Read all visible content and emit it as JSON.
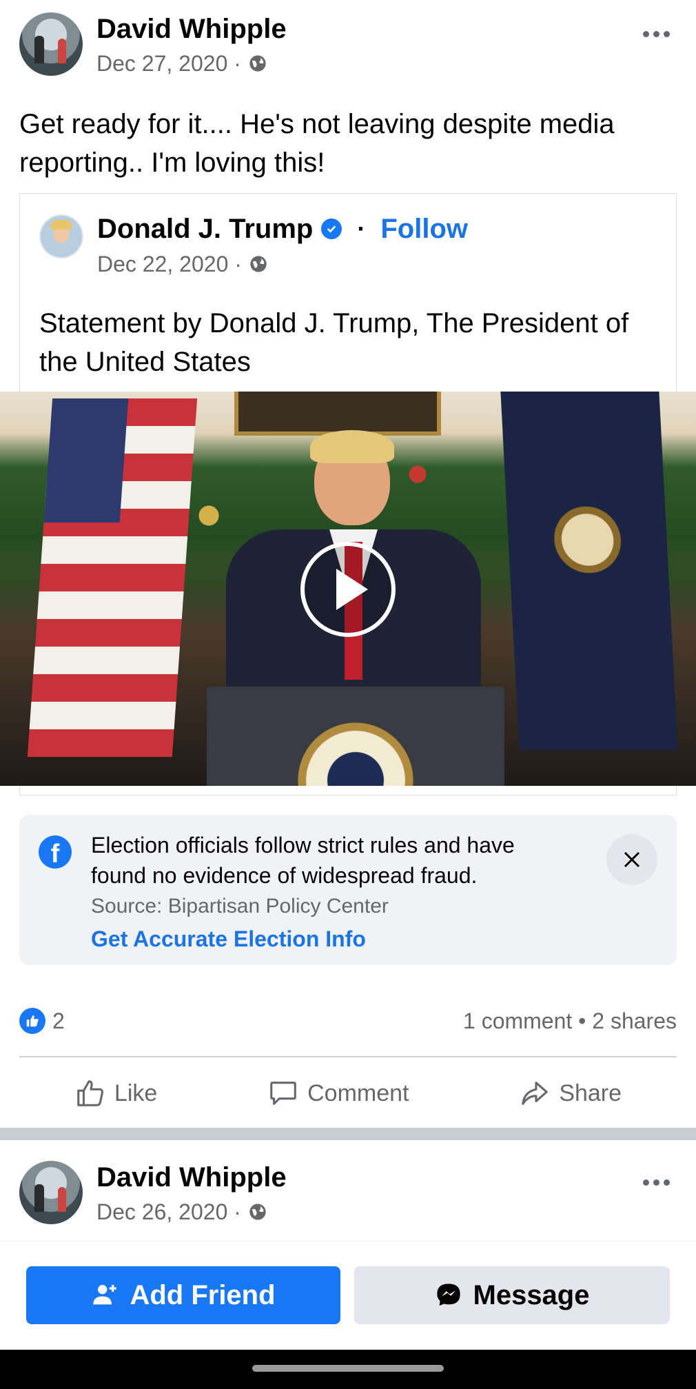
{
  "post": {
    "author": "David Whipple",
    "date": "Dec 27, 2020 ·",
    "text": "Get ready for it.... He's not leaving despite media reporting..  I'm loving this!"
  },
  "shared_post": {
    "author": "Donald J. Trump",
    "separator": "·",
    "follow_label": "Follow",
    "date": "Dec 22, 2020 ·",
    "text": "Statement by Donald J. Trump, The President of the United States"
  },
  "info_card": {
    "logo_letter": "f",
    "text": "Election officials follow strict rules and have found no evidence of widespread fraud.",
    "source": "Source: Bipartisan Policy Center",
    "link": "Get Accurate Election Info"
  },
  "stats": {
    "like_count": "2",
    "comments_shares": "1 comment • 2 shares"
  },
  "actions": {
    "like": "Like",
    "comment": "Comment",
    "share": "Share"
  },
  "next_post": {
    "author": "David Whipple",
    "date": "Dec 26, 2020 ·"
  },
  "bottom_bar": {
    "add_friend": "Add Friend",
    "message": "Message"
  },
  "colors": {
    "accent": "#1877f2",
    "link": "#1b74e4",
    "secondary_text": "#65676b"
  }
}
